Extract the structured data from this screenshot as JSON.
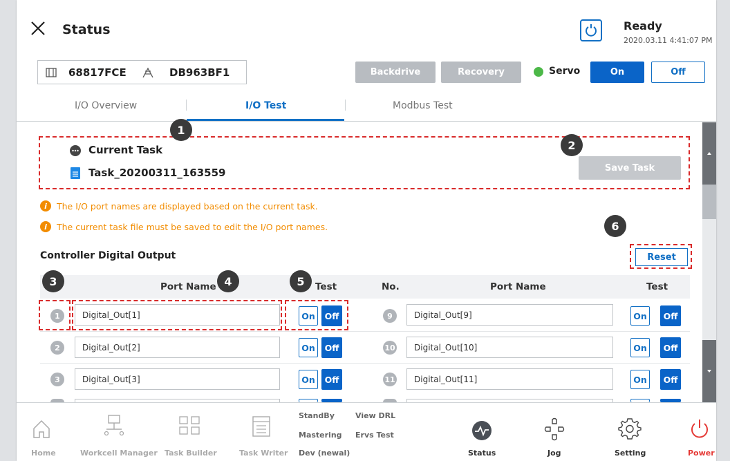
{
  "header": {
    "title": "Status",
    "status": "Ready",
    "timestamp": "2020.03.11 4:41:07 PM"
  },
  "idbar": {
    "robot_id": "68817FCE",
    "controller_id": "DB963BF1"
  },
  "toolbar": {
    "backdrive": "Backdrive",
    "recovery": "Recovery",
    "servo_label": "Servo",
    "servo_on": "On",
    "servo_off": "Off",
    "servo_status_color": "#4cb848"
  },
  "tabs": [
    {
      "label": "I/O Overview",
      "active": false
    },
    {
      "label": "I/O Test",
      "active": true
    },
    {
      "label": "Modbus Test",
      "active": false
    }
  ],
  "task": {
    "current_task_label": "Current Task",
    "task_name": "Task_20200311_163559",
    "save_label": "Save Task"
  },
  "notes": [
    "The I/O port names are displayed based on the current task.",
    "The current task file must be saved to edit the I/O port names."
  ],
  "section_title": "Controller Digital Output",
  "reset_label": "Reset",
  "table": {
    "headers": {
      "no": "No.",
      "port_name": "Port Name",
      "test": "Test"
    },
    "on_label": "On",
    "off_label": "Off",
    "left_rows": [
      {
        "no": "1",
        "name": "Digital_Out[1]"
      },
      {
        "no": "2",
        "name": "Digital_Out[2]"
      },
      {
        "no": "3",
        "name": "Digital_Out[3]"
      }
    ],
    "right_rows": [
      {
        "no": "9",
        "name": "Digital_Out[9]"
      },
      {
        "no": "10",
        "name": "Digital_Out[10]"
      },
      {
        "no": "11",
        "name": "Digital_Out[11]"
      }
    ]
  },
  "callouts": [
    "1",
    "2",
    "3",
    "4",
    "5",
    "6"
  ],
  "nav": {
    "home": "Home",
    "workcell_manager": "Workcell Manager",
    "task_builder": "Task Builder",
    "task_writer": "Task Writer",
    "standby": "StandBy",
    "view_drl": "View DRL",
    "mastering": "Mastering",
    "ervs_test": "Ervs Test",
    "dev": "Dev (newal)",
    "status": "Status",
    "jog": "Jog",
    "setting": "Setting",
    "power": "Power",
    "power_color": "#e53935",
    "accent_color": "#1270c5"
  }
}
